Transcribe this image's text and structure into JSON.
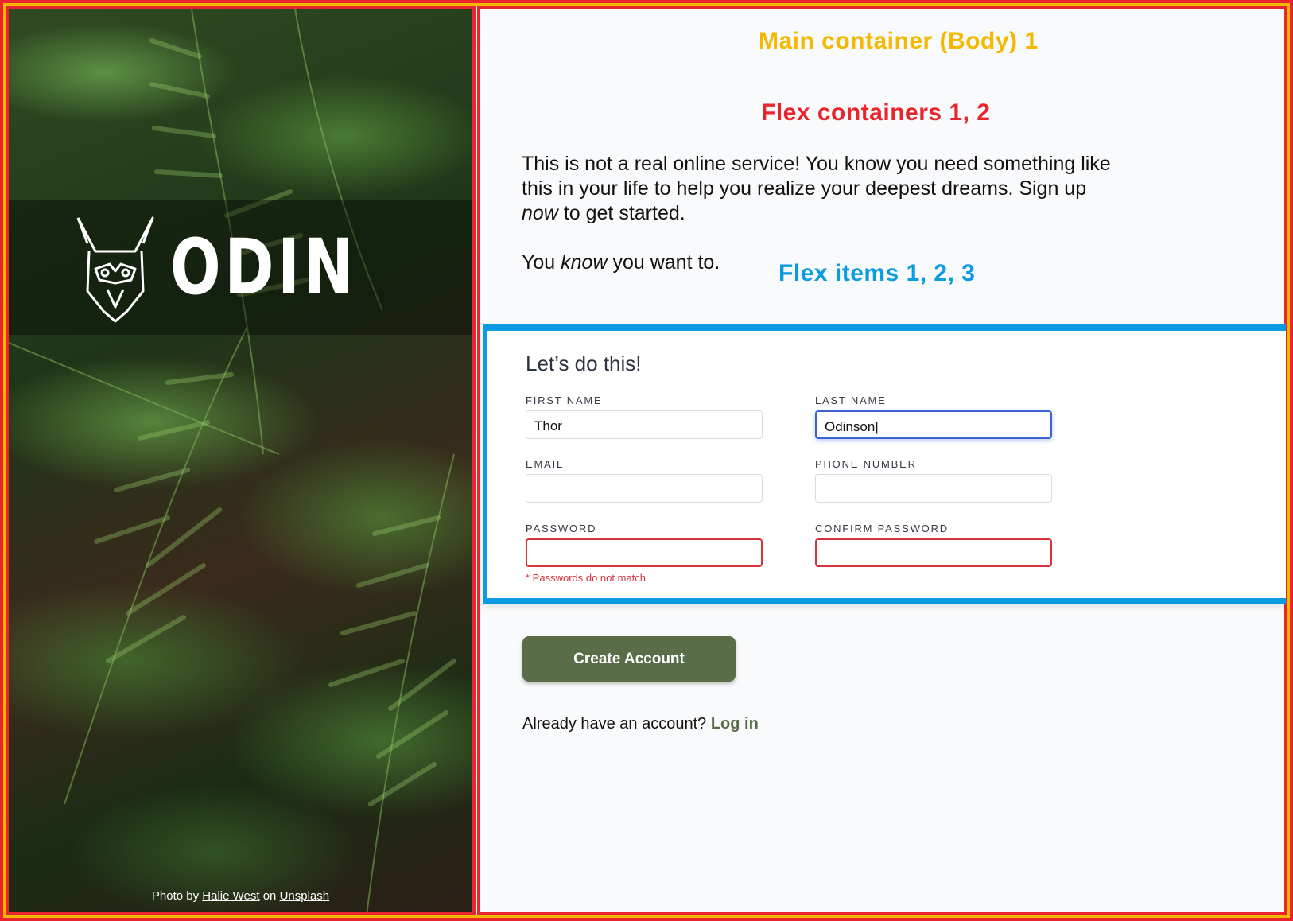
{
  "annotations": {
    "body": "Main container (Body) 1",
    "flex_containers": "Flex containers 1, 2",
    "flex_items": "Flex items 1, 2, 3"
  },
  "brand": {
    "logo_text": "ODIN"
  },
  "credit": {
    "prefix": "Photo by",
    "author": "Halie West",
    "on": "on",
    "site": "Unsplash"
  },
  "intro": {
    "line1": "This is not a real online service! You know you need something like this in your life to help you realize your deepest dreams. Sign up",
    "line1_em": "now",
    "line1_end": "to get started.",
    "line2_start": "You",
    "line2_em": "know",
    "line2_end": "you want to."
  },
  "form": {
    "title": "Let’s do this!",
    "fields": [
      {
        "label": "First Name",
        "value": "Thor"
      },
      {
        "label": "Last Name",
        "value": "Odinson|"
      },
      {
        "label": "Email",
        "value": ""
      },
      {
        "label": "Phone Number",
        "value": ""
      },
      {
        "label": "Password",
        "value": ""
      },
      {
        "label": "Confirm Password",
        "value": ""
      }
    ],
    "error": "* Passwords do not match"
  },
  "actions": {
    "create_label": "Create Account",
    "login_prompt": "Already have an account?",
    "login_link": "Log in"
  },
  "colors": {
    "annotation_red": "#e8242c",
    "annotation_yellow": "#f5b800",
    "annotation_blue": "#0a9be2",
    "brand_green": "#596d48",
    "error_red": "#d8313b",
    "focus_blue": "#3b63d6"
  }
}
